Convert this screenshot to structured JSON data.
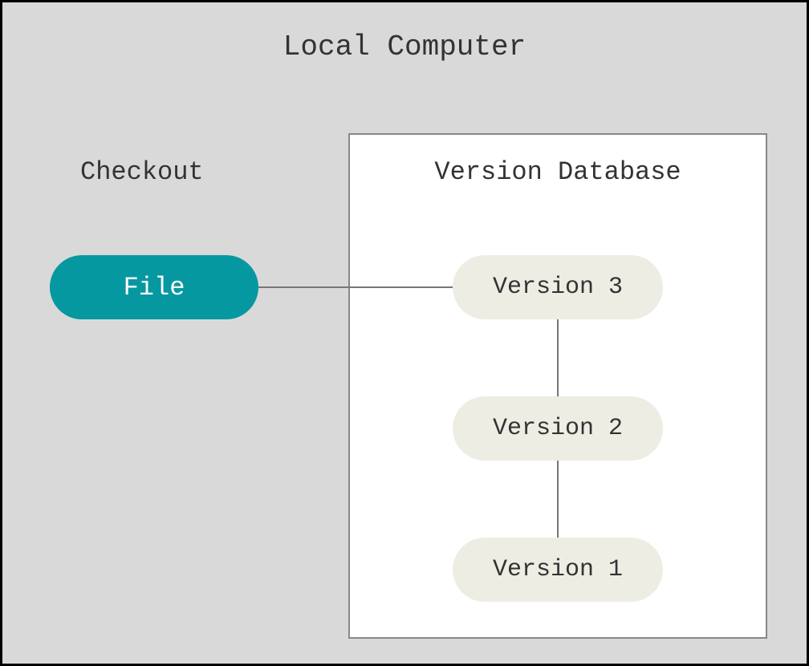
{
  "title": "Local Computer",
  "checkout_label": "Checkout",
  "file_node": {
    "label": "File"
  },
  "version_db": {
    "title": "Version Database",
    "versions": [
      {
        "label": "Version 3"
      },
      {
        "label": "Version 2"
      },
      {
        "label": "Version 1"
      }
    ]
  }
}
